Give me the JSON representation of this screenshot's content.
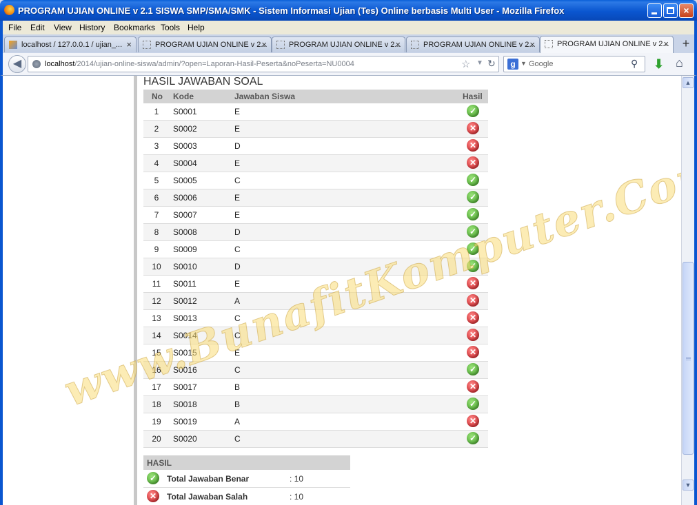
{
  "window": {
    "title": "PROGRAM UJIAN ONLINE v 2.1 SISWA SMP/SMA/SMK - Sistem Informasi Ujian (Tes) Online berbasis Multi User - Mozilla Firefox"
  },
  "menu": [
    "File",
    "Edit",
    "View",
    "History",
    "Bookmarks",
    "Tools",
    "Help"
  ],
  "tabs": [
    {
      "label": "localhost / 127.0.0.1 / ujian_...",
      "close": "×"
    },
    {
      "label": "PROGRAM UJIAN ONLINE v 2...",
      "close": "×"
    },
    {
      "label": "PROGRAM UJIAN ONLINE v 2...",
      "close": "×"
    },
    {
      "label": "PROGRAM UJIAN ONLINE v 2...",
      "close": "×"
    },
    {
      "label": "PROGRAM UJIAN ONLINE v 2...",
      "close": "×"
    }
  ],
  "newtab": "+",
  "nav": {
    "url_host": "localhost",
    "url_path": "/2014/ujian-online-siswa/admin/?open=Laporan-Hasil-Peserta&noPeserta=NU0004",
    "search_placeholder": "Google"
  },
  "page": {
    "heading": "HASIL JAWABAN SOAL",
    "columns": {
      "no": "No",
      "kode": "Kode",
      "jawaban": "Jawaban Siswa",
      "hasil": "Hasil"
    },
    "rows": [
      {
        "no": "1",
        "kode": "S0001",
        "jawaban": "E",
        "correct": true
      },
      {
        "no": "2",
        "kode": "S0002",
        "jawaban": "E",
        "correct": false
      },
      {
        "no": "3",
        "kode": "S0003",
        "jawaban": "D",
        "correct": false
      },
      {
        "no": "4",
        "kode": "S0004",
        "jawaban": "E",
        "correct": false
      },
      {
        "no": "5",
        "kode": "S0005",
        "jawaban": "C",
        "correct": true
      },
      {
        "no": "6",
        "kode": "S0006",
        "jawaban": "E",
        "correct": true
      },
      {
        "no": "7",
        "kode": "S0007",
        "jawaban": "E",
        "correct": true
      },
      {
        "no": "8",
        "kode": "S0008",
        "jawaban": "D",
        "correct": true
      },
      {
        "no": "9",
        "kode": "S0009",
        "jawaban": "C",
        "correct": true
      },
      {
        "no": "10",
        "kode": "S0010",
        "jawaban": "D",
        "correct": true
      },
      {
        "no": "11",
        "kode": "S0011",
        "jawaban": "E",
        "correct": false
      },
      {
        "no": "12",
        "kode": "S0012",
        "jawaban": "A",
        "correct": false
      },
      {
        "no": "13",
        "kode": "S0013",
        "jawaban": "C",
        "correct": false
      },
      {
        "no": "14",
        "kode": "S0014",
        "jawaban": "C",
        "correct": false
      },
      {
        "no": "15",
        "kode": "S0015",
        "jawaban": "E",
        "correct": false
      },
      {
        "no": "16",
        "kode": "S0016",
        "jawaban": "C",
        "correct": true
      },
      {
        "no": "17",
        "kode": "S0017",
        "jawaban": "B",
        "correct": false
      },
      {
        "no": "18",
        "kode": "S0018",
        "jawaban": "B",
        "correct": true
      },
      {
        "no": "19",
        "kode": "S0019",
        "jawaban": "A",
        "correct": false
      },
      {
        "no": "20",
        "kode": "S0020",
        "jawaban": "C",
        "correct": true
      }
    ],
    "summary": {
      "title": "HASIL",
      "benar_label": "Total Jawaban Benar",
      "benar_value": ": 10",
      "salah_label": "Total Jawaban Salah",
      "salah_value": ": 10"
    },
    "watermark": "www.BunafitKomputer.Com"
  },
  "icons": {
    "correct": "check-circle-icon",
    "wrong": "cross-circle-icon"
  },
  "colors": {
    "correct": "#3c9b22",
    "wrong": "#c3141a",
    "titlebar": "#0a56d0"
  }
}
